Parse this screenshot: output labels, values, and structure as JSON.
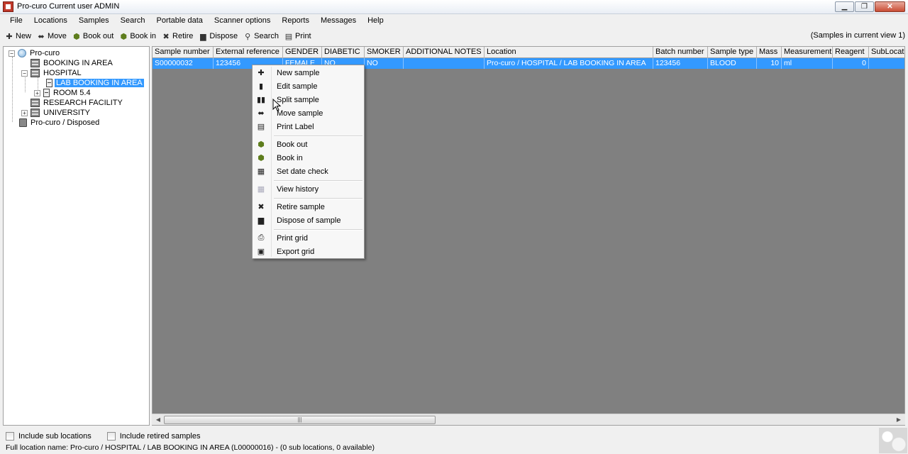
{
  "window": {
    "title": "Pro-curo  Current user ADMIN",
    "controls": [
      "minimize",
      "maximize",
      "close"
    ]
  },
  "menu": [
    "File",
    "Locations",
    "Samples",
    "Search",
    "Portable data",
    "Scanner options",
    "Reports",
    "Messages",
    "Help"
  ],
  "toolbar": {
    "buttons": [
      {
        "label": "New",
        "icon": "plus-icon"
      },
      {
        "label": "Move",
        "icon": "move-arrows-icon"
      },
      {
        "label": "Book out",
        "icon": "book-out-icon"
      },
      {
        "label": "Book in",
        "icon": "book-in-icon"
      },
      {
        "label": "Retire",
        "icon": "x-icon"
      },
      {
        "label": "Dispose",
        "icon": "bin-icon"
      },
      {
        "label": "Search",
        "icon": "magnifier-icon"
      },
      {
        "label": "Print",
        "icon": "printer-icon"
      }
    ],
    "view_status": "(Samples in current view 1)"
  },
  "tree": {
    "nodes": [
      {
        "label": "Pro-curo",
        "icon": "globe-icon"
      },
      {
        "label": "BOOKING IN AREA",
        "icon": "building-icon"
      },
      {
        "label": "HOSPITAL",
        "icon": "building-icon"
      },
      {
        "label": "LAB BOOKING IN AREA",
        "icon": "fridge-icon",
        "selected": true
      },
      {
        "label": "ROOM 5.4",
        "icon": "fridge-icon"
      },
      {
        "label": "RESEARCH FACILITY",
        "icon": "building-icon"
      },
      {
        "label": "UNIVERSITY",
        "icon": "building-icon"
      },
      {
        "label": "Pro-curo / Disposed",
        "icon": "bin-icon"
      }
    ]
  },
  "grid": {
    "columns": [
      "Sample number",
      "External reference",
      "GENDER",
      "DIABETIC",
      "SMOKER",
      "ADDITIONAL NOTES",
      "Location",
      "Batch number",
      "Sample type",
      "Mass",
      "Measurement",
      "Reagent",
      "SubLocat"
    ],
    "rows": [
      [
        "S00000032",
        "123456",
        "FEMALE",
        "NO",
        "NO",
        "",
        "Pro-curo / HOSPITAL / LAB BOOKING IN AREA",
        "123456",
        "BLOOD",
        "10",
        "ml",
        "0",
        ""
      ]
    ]
  },
  "context_menu": {
    "items": [
      {
        "label": "New sample",
        "icon": "plus-icon"
      },
      {
        "label": "Edit sample",
        "icon": "edit-tube-icon"
      },
      {
        "label": "Split sample",
        "icon": "split-tubes-icon"
      },
      {
        "label": "Move sample",
        "icon": "move-arrows-icon"
      },
      {
        "label": "Print Label",
        "icon": "label-icon"
      },
      {
        "label": "Book out",
        "icon": "book-out-icon"
      },
      {
        "label": "Book in",
        "icon": "book-in-icon"
      },
      {
        "label": "Set date check",
        "icon": "calendar-icon"
      },
      {
        "label": "View history",
        "icon": "grid-icon"
      },
      {
        "label": "Retire sample",
        "icon": "x-icon"
      },
      {
        "label": "Dispose of sample",
        "icon": "bin-icon"
      },
      {
        "label": "Print grid",
        "icon": "printer-icon"
      },
      {
        "label": "Export grid",
        "icon": "disk-icon"
      }
    ]
  },
  "options": {
    "include_sub_locations": {
      "label": "Include sub locations",
      "checked": false
    },
    "include_retired_samples": {
      "label": "Include retired samples",
      "checked": false
    }
  },
  "status": {
    "full_location": "Full location name:  Pro-curo / HOSPITAL / LAB BOOKING IN AREA  (L00000016)  - (0 sub locations, 0 available)"
  }
}
